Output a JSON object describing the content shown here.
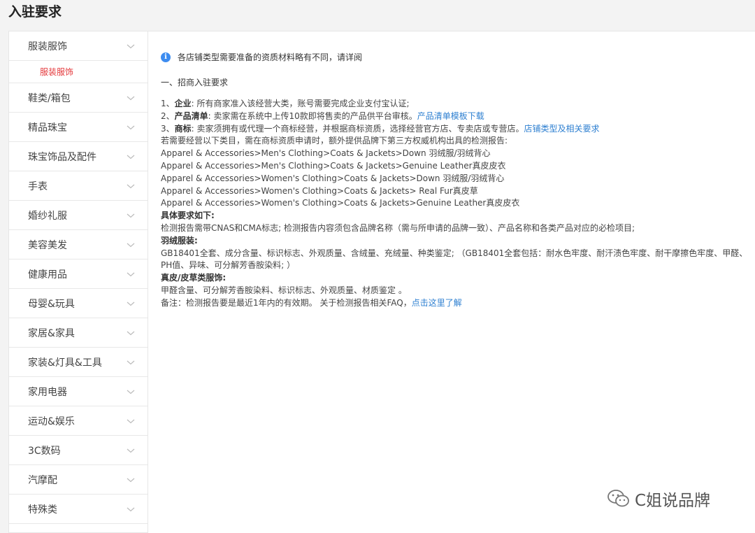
{
  "page_title": "入驻要求",
  "sidebar": {
    "categories": [
      {
        "label": "服装服饰",
        "sub": "服装服饰"
      },
      {
        "label": "鞋类/箱包"
      },
      {
        "label": "精品珠宝"
      },
      {
        "label": "珠宝饰品及配件"
      },
      {
        "label": "手表"
      },
      {
        "label": "婚纱礼服"
      },
      {
        "label": "美容美发"
      },
      {
        "label": "健康用品"
      },
      {
        "label": "母婴&玩具"
      },
      {
        "label": "家居&家具"
      },
      {
        "label": "家装&灯具&工具"
      },
      {
        "label": "家用电器"
      },
      {
        "label": "运动&娱乐"
      },
      {
        "label": "3C数码"
      },
      {
        "label": "汽摩配"
      },
      {
        "label": "特殊类"
      }
    ]
  },
  "main": {
    "notice": "各店铺类型需要准备的资质材料略有不同，请详阅",
    "section_title": "一、招商入驻要求",
    "req1_num": "1、",
    "req1_label": "企业",
    "req1_text": ": 所有商家准入该经营大类，账号需要完成企业支付宝认证;",
    "req2_num": "2、",
    "req2_label": "产品清单",
    "req2_text": ": 卖家需在系统中上传10款即将售卖的产品供平台审核。",
    "req2_link": "产品清单模板下载",
    "req3_num": "3、",
    "req3_label": "商标",
    "req3_text": ": 卖家须拥有或代理一个商标经营，并根据商标资质，选择经营官方店、专卖店或专营店。",
    "req3_link": "店铺类型及相关要求",
    "extra_intro": "若需要经营以下类目，需在商标资质申请时，额外提供品牌下第三方权威机构出具的检测报告:",
    "categories_list": [
      "Apparel & Accessories>Men's Clothing>Coats & Jackets>Down 羽绒服/羽绒背心",
      "Apparel & Accessories>Men's Clothing>Coats & Jackets>Genuine Leather真皮皮衣",
      "Apparel & Accessories>Women's Clothing>Coats & Jackets>Down 羽绒服/羽绒背心",
      "Apparel & Accessories>Women's Clothing>Coats & Jackets> Real Fur真皮草",
      "Apparel & Accessories>Women's Clothing>Coats & Jackets>Genuine Leather真皮皮衣"
    ],
    "specific_title": "具体要求如下:",
    "specific_text": "检测报告需带CNAS和CMA标志; 检测报告内容须包含品牌名称（需与所申请的品牌一致）、产品名称和各类产品对应的必检项目;",
    "down_title": "羽绒服装:",
    "down_text": "GB18401全套、成分含量、标识标志、外观质量、含绒量、充绒量、种类鉴定; （GB18401全套包括：耐水色牢度、耐汗渍色牢度、耐干摩擦色牢度、甲醛、PH值、异味、可分解芳香胺染料; ）",
    "leather_title": "真皮/皮草类服饰:",
    "leather_text": "甲醛含量、可分解芳香胺染料、标识标志、外观质量、材质鉴定 。",
    "remark_text": "备注：检测报告要是最近1年内的有效期。 关于检测报告相关FAQ，",
    "remark_link": "点击这里了解"
  },
  "watermark": "C姐说品牌",
  "colors": {
    "accent_red": "#e4393c",
    "link_blue": "#2f80d1",
    "info_blue": "#3d8cf0"
  }
}
